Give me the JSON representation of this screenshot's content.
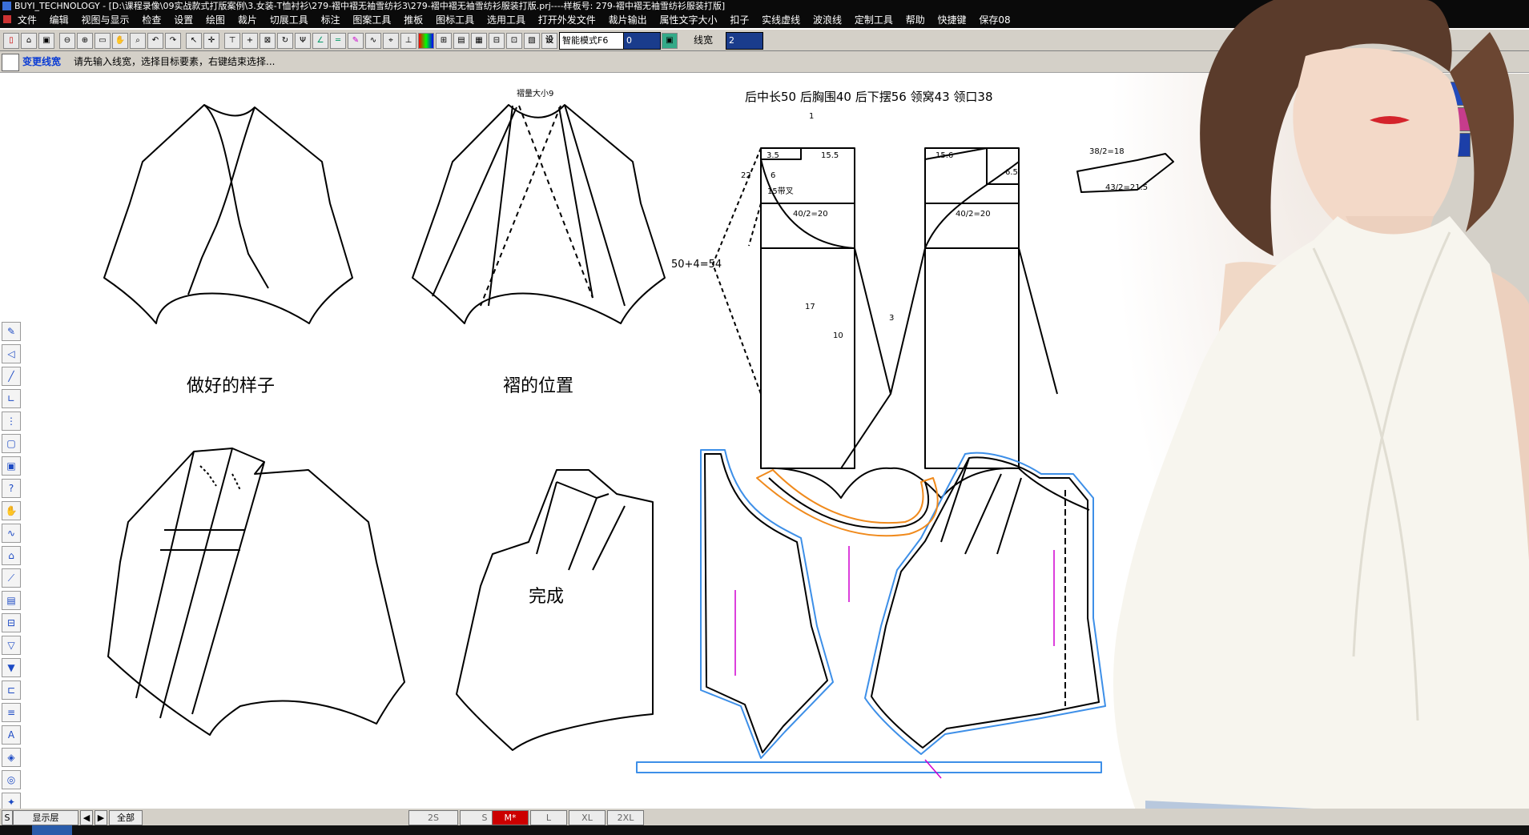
{
  "window": {
    "title": "BUYI_TECHNOLOGY - [D:\\课程录像\\09实战款式打版案例\\3.女装-T恤衬衫\\279-褶中褶无袖雪纺衫3\\279-褶中褶无袖雪纺衫服装打版.prj----样板号: 279-褶中褶无袖雪纺衫服装打版]"
  },
  "menu": [
    "文件",
    "编辑",
    "视图与显示",
    "检查",
    "设置",
    "绘图",
    "裁片",
    "切展工具",
    "标注",
    "图案工具",
    "推板",
    "图标工具",
    "选用工具",
    "打开外发文件",
    "裁片输出",
    "属性文字大小",
    "扣子",
    "实线虚线",
    "波浪线",
    "定制工具",
    "帮助",
    "快捷键",
    "保存08"
  ],
  "toolbar": {
    "mode_select": "智能模式F6",
    "value_box": "0",
    "linewidth_label": "线宽",
    "linewidth_value": "2"
  },
  "prompt": {
    "tool_name": "变更线宽",
    "message": "请先输入线宽，选择目标要素，右键结束选择..."
  },
  "canvas": {
    "labels": {
      "done_shape": "做好的样子",
      "pleat_position": "褶的位置",
      "pleat_size": "褶量大小9",
      "finished": "完成",
      "measurements": "后中长50  后胸围40  后下摆56  领窝43  领口38",
      "front_length": "50+4=54",
      "chest_left": "40/2=20",
      "chest_right": "40/2=20",
      "collar_top": "38/2=18",
      "collar_bottom": "43/2=21.5",
      "dim_3_5": "3.5",
      "dim_15_5": "15.5",
      "dim_15_6": "15.6",
      "dim_6_5": "6.5",
      "dim_6": "6",
      "dim_22": "22",
      "dim_15_cross": "15带叉",
      "dim_17": "17",
      "dim_10": "10",
      "dim_3": "3",
      "dim_1": "1"
    },
    "colors": {
      "line": "#000000",
      "seam_blue": "#3d8fe8",
      "grain_magenta": "#d000d0",
      "orange": "#f08a1c",
      "green": "#2aa52a"
    }
  },
  "left_tools": [
    "pen-tool",
    "arrow-tool",
    "line-tool",
    "angle-tool",
    "mirror-tool",
    "rect-tool",
    "frame-tool",
    "help-tool",
    "hand-tool",
    "curve-tool",
    "measure-tool",
    "ruler-tool",
    "save-tool",
    "layer-tool",
    "dart-tool",
    "pleat-tool",
    "fold-tool",
    "align-tool",
    "text-tool",
    "fill-tool",
    "rotate-tool",
    "stamp-tool"
  ],
  "status": {
    "left_label": "S",
    "layer_label": "显示层",
    "all_label": "全部",
    "sizes": [
      "2S",
      "S",
      "M*",
      "L",
      "XL",
      "2XL"
    ]
  }
}
